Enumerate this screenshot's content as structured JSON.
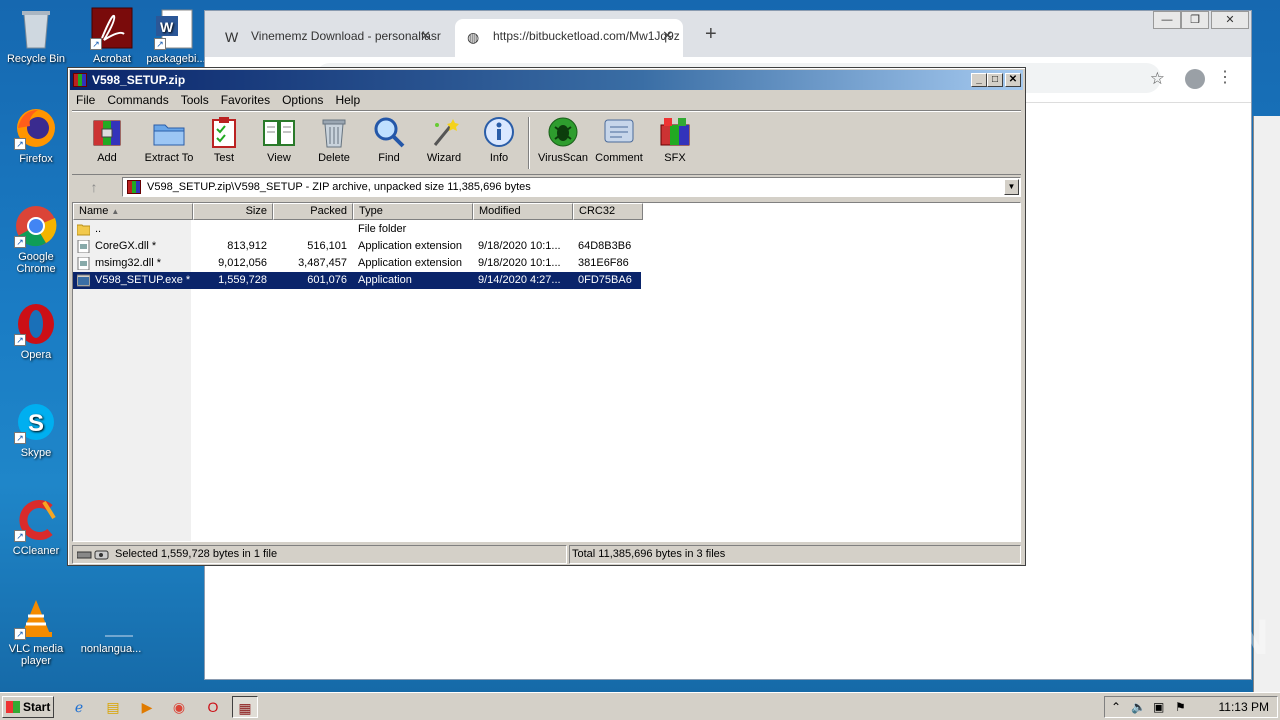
{
  "desktop": {
    "icons": [
      {
        "label": "Recycle Bin",
        "icon": "recycle-bin-icon"
      },
      {
        "label": "Acrobat",
        "icon": "acrobat-icon"
      },
      {
        "label": "packagebi...",
        "icon": "word-doc-icon"
      },
      {
        "label": "Firefox",
        "icon": "firefox-icon"
      },
      {
        "label": "Google Chrome",
        "icon": "chrome-icon"
      },
      {
        "label": "Opera",
        "icon": "opera-icon"
      },
      {
        "label": "Skype",
        "icon": "skype-icon"
      },
      {
        "label": "CCleaner",
        "icon": "ccleaner-icon"
      },
      {
        "label": "VLC media player",
        "icon": "vlc-icon"
      },
      {
        "label": "nonlangua...",
        "icon": "blank-file-icon"
      }
    ],
    "watermark": "ANY RUN"
  },
  "chrome": {
    "tabs": [
      {
        "label": "Vinememz Download - personalfasr",
        "icon": "w-favicon"
      },
      {
        "label": "https://bitbucketload.com/Mw1Jq9z",
        "icon": "globe-icon"
      }
    ],
    "newtab": "+",
    "omnibox": "",
    "controls": {
      "minimize": "—",
      "restore": "❐",
      "close": "✕"
    }
  },
  "winrar": {
    "title": "V598_SETUP.zip",
    "menu": [
      "File",
      "Commands",
      "Tools",
      "Favorites",
      "Options",
      "Help"
    ],
    "toolbar": [
      {
        "label": "Add",
        "icon": "add-archive-icon"
      },
      {
        "label": "Extract To",
        "icon": "extract-folder-icon"
      },
      {
        "label": "Test",
        "icon": "test-clipboard-icon"
      },
      {
        "label": "View",
        "icon": "view-book-icon"
      },
      {
        "label": "Delete",
        "icon": "trash-icon"
      },
      {
        "label": "Find",
        "icon": "magnifier-icon"
      },
      {
        "label": "Wizard",
        "icon": "wand-icon"
      },
      {
        "label": "Info",
        "icon": "info-icon"
      },
      {
        "label": "VirusScan",
        "icon": "bug-scan-icon"
      },
      {
        "label": "Comment",
        "icon": "comment-icon"
      },
      {
        "label": "SFX",
        "icon": "sfx-books-icon"
      }
    ],
    "address": "V598_SETUP.zip\\V598_SETUP - ZIP archive, unpacked size 11,385,696 bytes",
    "columns": [
      "Name",
      "Size",
      "Packed",
      "Type",
      "Modified",
      "CRC32"
    ],
    "rows": [
      {
        "name": "..",
        "size": "",
        "packed": "",
        "type": "File folder",
        "modified": "",
        "crc": "",
        "icon": "folder-icon"
      },
      {
        "name": "CoreGX.dll *",
        "size": "813,912",
        "packed": "516,101",
        "type": "Application extension",
        "modified": "9/18/2020 10:1...",
        "crc": "64D8B3B6",
        "icon": "dll-icon"
      },
      {
        "name": "msimg32.dll *",
        "size": "9,012,056",
        "packed": "3,487,457",
        "type": "Application extension",
        "modified": "9/18/2020 10:1...",
        "crc": "381E6F86",
        "icon": "dll-icon"
      },
      {
        "name": "V598_SETUP.exe *",
        "size": "1,559,728",
        "packed": "601,076",
        "type": "Application",
        "modified": "9/14/2020 4:27...",
        "crc": "0FD75BA6",
        "icon": "exe-icon",
        "selected": true
      }
    ],
    "status_left": "Selected 1,559,728 bytes in 1 file",
    "status_right": "Total 11,385,696 bytes in 3 files"
  },
  "taskbar": {
    "start": "Start",
    "quick": [
      "ie-icon",
      "explorer-icon",
      "media-player-icon",
      "chrome-icon",
      "opera-icon",
      "winrar-icon"
    ],
    "clock": "11:13 PM"
  }
}
